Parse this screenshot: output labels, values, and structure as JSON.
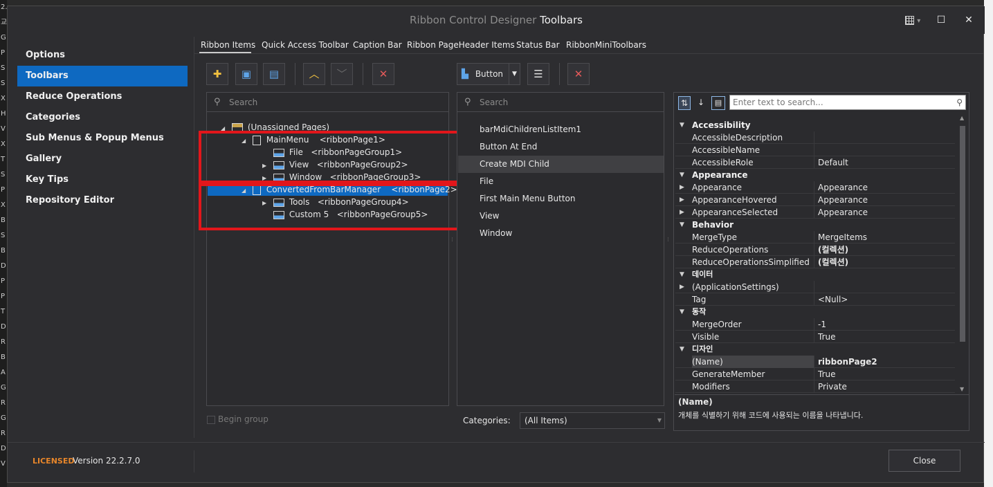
{
  "background": {
    "left_strip_chars": [
      "2.",
      "교",
      "G",
      "P",
      "S",
      "S",
      "X",
      "H",
      "V",
      "X",
      "T",
      "S",
      "P",
      "X",
      "B",
      "S",
      "B",
      "D",
      "P",
      "P",
      "T",
      "D",
      "R",
      "B",
      "A",
      "G",
      "R",
      "G",
      "R",
      "D",
      "V"
    ]
  },
  "window": {
    "title_prefix": "Ribbon Control Designer",
    "title_main": "Toolbars",
    "grid_icon": "grid-icon",
    "minimize_label": "▾",
    "maximize_label": "☐",
    "close_label": "✕"
  },
  "nav": {
    "items": [
      {
        "label": "Options",
        "selected": false
      },
      {
        "label": "Toolbars",
        "selected": true
      },
      {
        "label": "Reduce Operations",
        "selected": false
      },
      {
        "label": "Categories",
        "selected": false
      },
      {
        "label": "Sub Menus & Popup Menus",
        "selected": false
      },
      {
        "label": "Gallery",
        "selected": false
      },
      {
        "label": "Key Tips",
        "selected": false
      },
      {
        "label": "Repository Editor",
        "selected": false
      }
    ]
  },
  "tabs": [
    "Ribbon Items",
    "Quick Access Toolbar",
    "Caption Bar",
    "Ribbon PageHeader Items",
    "Status Bar",
    "RibbonMiniToolbars"
  ],
  "toolbar": {
    "item_type_label": "Button"
  },
  "tree": {
    "search_placeholder": "Search",
    "nodes": [
      {
        "text": "(Unassigned Pages)",
        "tag": ""
      },
      {
        "text": "MainMenu",
        "tag": "<ribbonPage1>"
      },
      {
        "text": "File",
        "tag": "<ribbonPageGroup1>"
      },
      {
        "text": "View",
        "tag": "<ribbonPageGroup2>"
      },
      {
        "text": "Window",
        "tag": "<ribbonPageGroup3>"
      },
      {
        "text": "ConvertedFromBarManager",
        "tag": "<ribbonPage2>"
      },
      {
        "text": "Tools",
        "tag": "<ribbonPageGroup4>"
      },
      {
        "text": "Custom 5",
        "tag": "<ribbonPageGroup5>"
      }
    ],
    "begin_group_label": "Begin group"
  },
  "items_list": {
    "search_placeholder": "Search",
    "items": [
      "barMdiChildrenListItem1",
      "Button At End",
      "Create MDI Child",
      "File",
      "First Main Menu Button",
      "View",
      "Window"
    ],
    "categories_label": "Categories:",
    "categories_value": "(All Items)"
  },
  "properties": {
    "search_placeholder": "Enter text to search...",
    "categories": [
      {
        "name": "Accessibility",
        "rows": [
          {
            "name": "AccessibleDescription",
            "value": "",
            "expandable": false,
            "bold": false
          },
          {
            "name": "AccessibleName",
            "value": "",
            "expandable": false,
            "bold": false
          },
          {
            "name": "AccessibleRole",
            "value": "Default",
            "expandable": false,
            "bold": false
          }
        ]
      },
      {
        "name": "Appearance",
        "rows": [
          {
            "name": "Appearance",
            "value": "Appearance",
            "expandable": true,
            "bold": false
          },
          {
            "name": "AppearanceHovered",
            "value": "Appearance",
            "expandable": true,
            "bold": false
          },
          {
            "name": "AppearanceSelected",
            "value": "Appearance",
            "expandable": true,
            "bold": false
          }
        ]
      },
      {
        "name": "Behavior",
        "rows": [
          {
            "name": "MergeType",
            "value": "MergeItems",
            "expandable": false,
            "bold": false
          },
          {
            "name": "ReduceOperations",
            "value": "(컬렉션)",
            "expandable": false,
            "bold": true
          },
          {
            "name": "ReduceOperationsSimplified",
            "value": "(컬렉션)",
            "expandable": false,
            "bold": true
          }
        ]
      },
      {
        "name": "데이터",
        "rows": [
          {
            "name": "(ApplicationSettings)",
            "value": "",
            "expandable": true,
            "bold": false
          },
          {
            "name": "Tag",
            "value": "<Null>",
            "expandable": false,
            "bold": false
          }
        ]
      },
      {
        "name": "동작",
        "rows": [
          {
            "name": "MergeOrder",
            "value": "-1",
            "expandable": false,
            "bold": false
          },
          {
            "name": "Visible",
            "value": "True",
            "expandable": false,
            "bold": false
          }
        ]
      },
      {
        "name": "디자인",
        "rows": [
          {
            "name": "(Name)",
            "value": "ribbonPage2",
            "expandable": false,
            "bold": true,
            "highlight": true
          },
          {
            "name": "GenerateMember",
            "value": "True",
            "expandable": false,
            "bold": false
          },
          {
            "name": "Modifiers",
            "value": "Private",
            "expandable": false,
            "bold": false
          }
        ]
      }
    ],
    "description_title": "(Name)",
    "description_text": "개체를 식별하기 위해 코드에 사용되는 이름을 나타냅니다."
  },
  "footer": {
    "license_label": "LICENSED",
    "version_label": "Version 22.2.7.0",
    "close_label": "Close"
  },
  "colors": {
    "accent": "#0e69c1",
    "highlight_box": "#e2161b",
    "license": "#e8862a",
    "delete": "#e35a5a"
  }
}
